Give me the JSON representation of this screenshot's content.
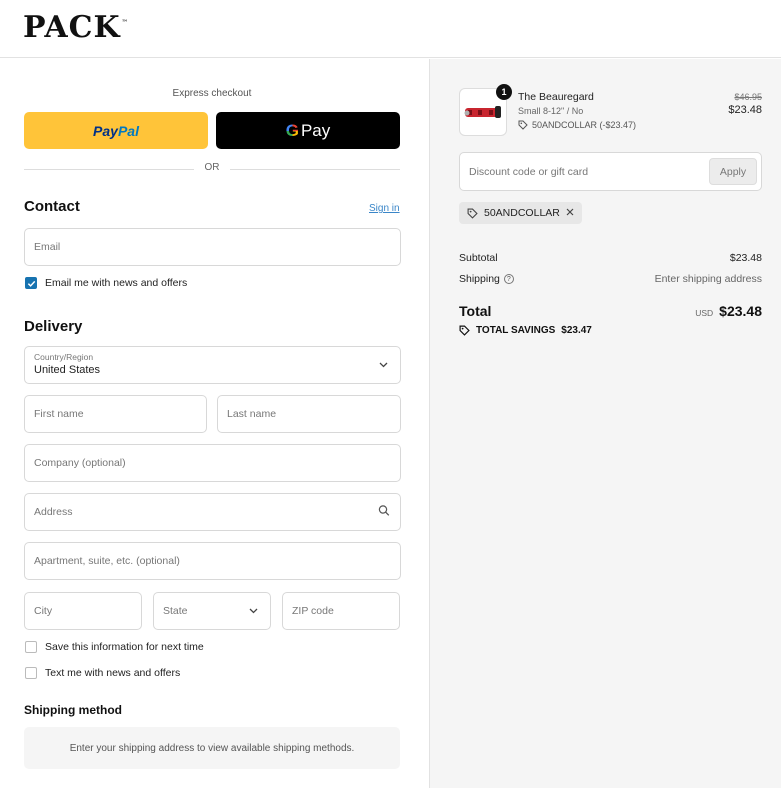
{
  "brand": {
    "logo_text": "PACK",
    "trademark": "™"
  },
  "express": {
    "label": "Express checkout",
    "paypal_pay": "Pay",
    "paypal_pal": "Pal",
    "gpay_label": "Pay",
    "or_text": "OR"
  },
  "contact": {
    "title": "Contact",
    "signin_label": "Sign in",
    "email_placeholder": "Email",
    "email_news_label": "Email me with news and offers",
    "email_news_checked": true
  },
  "delivery": {
    "title": "Delivery",
    "country_label": "Country/Region",
    "country_value": "United States",
    "first_name_placeholder": "First name",
    "last_name_placeholder": "Last name",
    "company_placeholder": "Company (optional)",
    "address_placeholder": "Address",
    "apartment_placeholder": "Apartment, suite, etc. (optional)",
    "city_placeholder": "City",
    "state_placeholder": "State",
    "zip_placeholder": "ZIP code",
    "save_info_label": "Save this information for next time",
    "text_news_label": "Text me with news and offers"
  },
  "shipping_method": {
    "title": "Shipping method",
    "message": "Enter your shipping address to view available shipping methods."
  },
  "order": {
    "item": {
      "quantity": "1",
      "name": "The Beauregard",
      "variant": "Small 8-12\" / No",
      "discount": "50ANDCOLLAR (-$23.47)",
      "original_price": "$46.95",
      "price": "$23.48"
    },
    "discount_placeholder": "Discount code or gift card",
    "apply_label": "Apply",
    "applied_code": "50ANDCOLLAR",
    "subtotal_label": "Subtotal",
    "subtotal_value": "$23.48",
    "shipping_label": "Shipping",
    "shipping_value": "Enter shipping address",
    "total_label": "Total",
    "total_currency": "USD",
    "total_value": "$23.48",
    "savings_label": "TOTAL SAVINGS",
    "savings_value": "$23.47"
  },
  "colors": {
    "paypal_yellow": "#ffc439",
    "accent_blue": "#1773b0",
    "link_blue": "#3a86c8",
    "summary_bg": "#f5f5f5"
  },
  "icons": [
    "search-icon",
    "chevron-down-icon",
    "tag-icon",
    "close-icon",
    "help-icon",
    "check-icon"
  ]
}
